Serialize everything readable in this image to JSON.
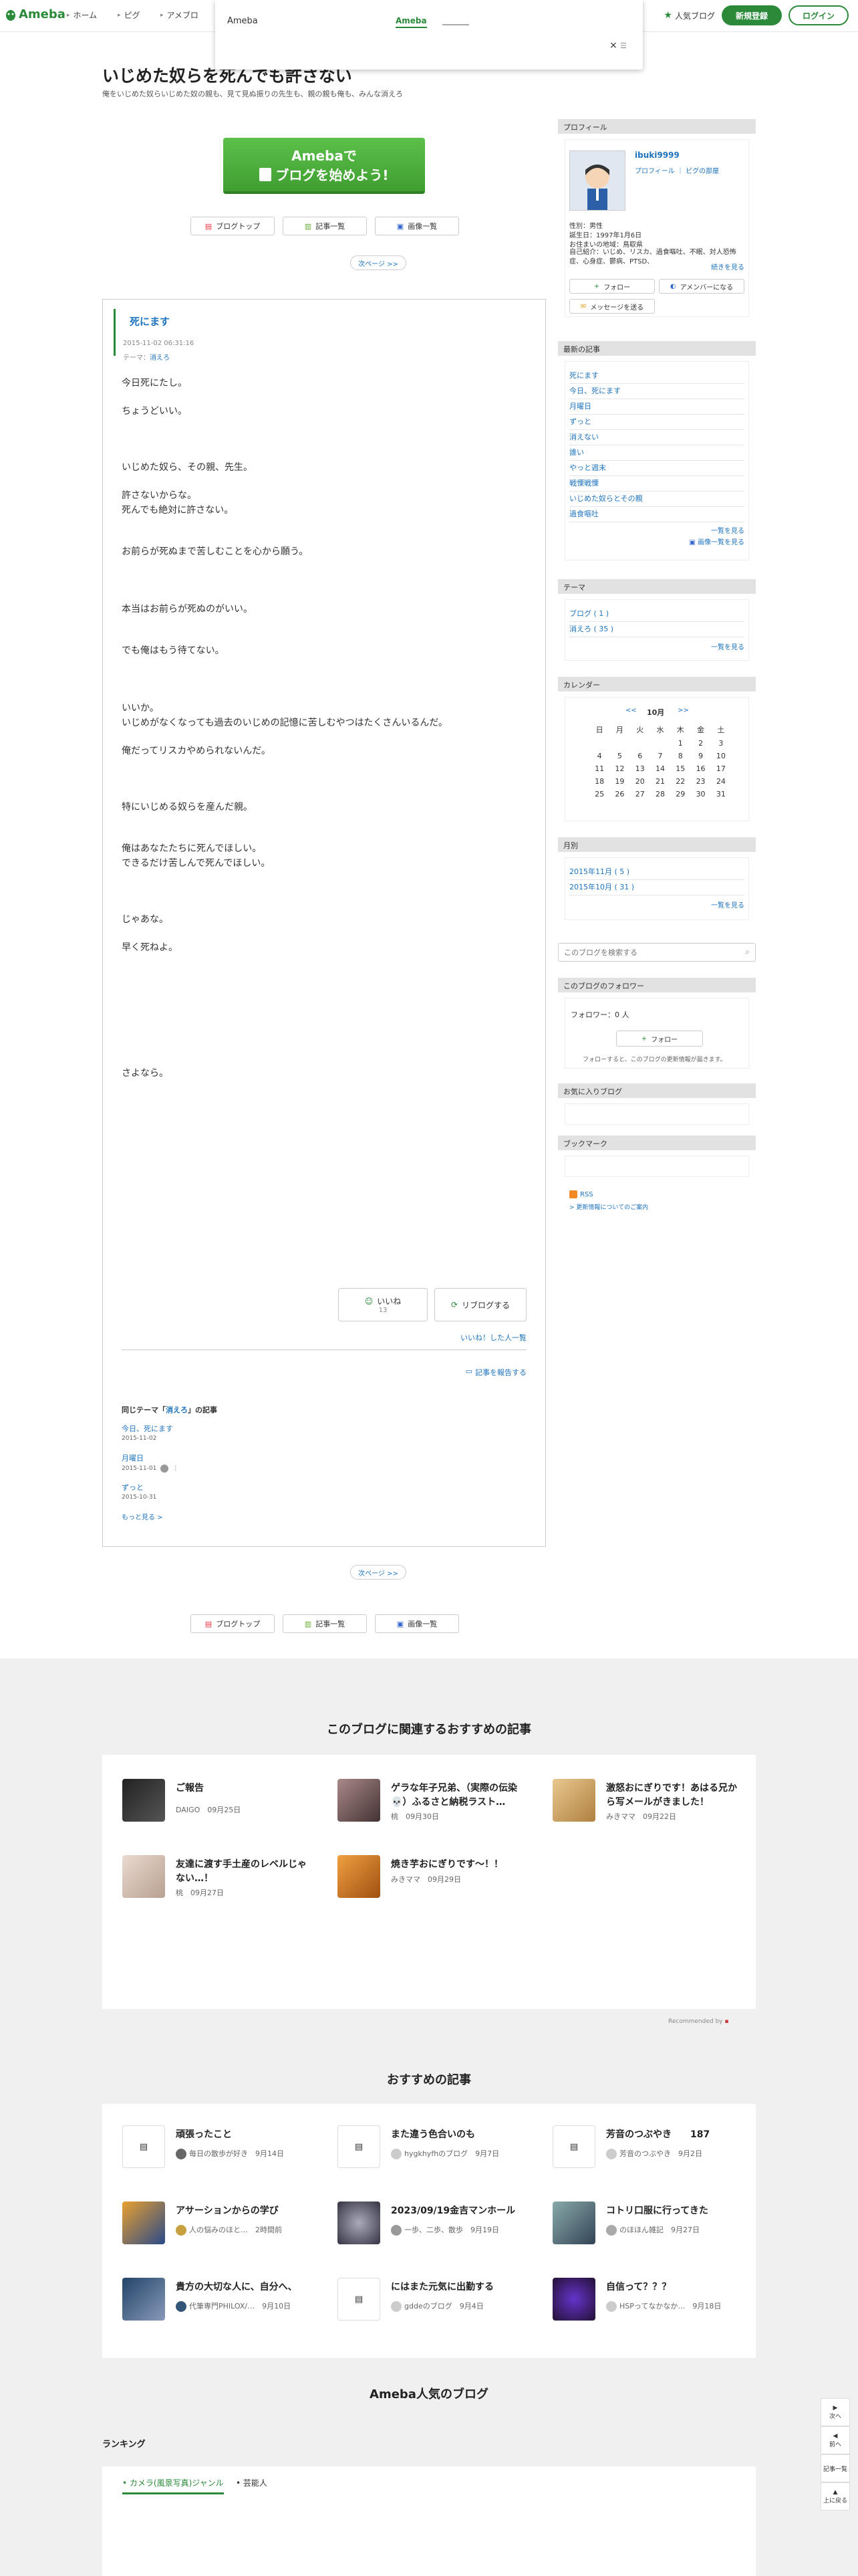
{
  "header": {
    "logo": "Ameba",
    "nav": [
      "ホーム",
      "ピグ",
      "アメブロ"
    ],
    "popup_title": "Ameba",
    "popup_link": "Ameba",
    "popup_close": "×",
    "popular": "人気ブログ",
    "signup": "新規登録",
    "login": "ログイン"
  },
  "blog": {
    "title": "いじめた奴らを死んでも許さない",
    "description": "俺をいじめた奴らいじめた奴の親も、見て見ぬ振りの先生も、親の親も俺も、みんな消えろ"
  },
  "banner": {
    "line1": "Amebaで",
    "line2": "ブログを始めよう!"
  },
  "blog_nav": {
    "top": "ブログトップ",
    "list": "記事一覧",
    "images": "画像一覧",
    "next": "次ページ >>"
  },
  "article": {
    "title": "死にます",
    "date": "2015-11-02 06:31:16",
    "theme_label": "テーマ：",
    "theme": "消えろ",
    "body": [
      "今日死にたし。",
      "ちょうどいい。",
      "いじめた奴ら、その親、先生。",
      "許さないからな。",
      "死んでも絶対に許さない。",
      "お前らが死ぬまで苦しむことを心から願う。",
      "本当はお前らが死ぬのがいい。",
      "でも俺はもう待てない。",
      "いいか。",
      "いじめがなくなっても過去のいじめの記憶に苦しむやつはたくさんいるんだ。",
      "俺だってリスカやめられないんだ。",
      "特にいじめる奴らを産んだ親。",
      "俺はあなたたちに死んでほしい。",
      "できるだけ苦しんで死んでほしい。",
      "じゃあな。",
      "早く死ねよ。",
      "さよなら。"
    ],
    "like": "いいね",
    "like_count": "13",
    "reblog": "リブログする",
    "liked_by": "いいね！した人一覧",
    "report": "記事を報告する",
    "same_theme_prefix": "同じテーマ「",
    "same_theme_name": "消えろ",
    "same_theme_suffix": "」の記事",
    "related": [
      {
        "title": "今日、死にます",
        "date": "2015-11-02"
      },
      {
        "title": "月曜日",
        "date": "2015-11-01"
      },
      {
        "title": "ずっと",
        "date": "2015-10-31"
      }
    ],
    "more": "もっと見る >"
  },
  "sidebar": {
    "profile": {
      "heading": "プロフィール",
      "name": "ibuki9999",
      "links": "プロフィール ｜ ピグの部屋",
      "gender": "性別：男性",
      "birthday": "誕生日：1997年1月6日",
      "region": "お住まいの地域：鳥取県",
      "intro": "自己紹介：いじめ、リスカ、過食嘔吐、不眠、対人恐怖症、心身症、鬱病、PTSD、",
      "read_more": "続きを見る",
      "follow": "フォロー",
      "member": "アメンバーになる",
      "message": "メッセージを送る"
    },
    "recent": {
      "heading": "最新の記事",
      "items": [
        "死にます",
        "今日、死にます",
        "月曜日",
        "ずっと",
        "消えない",
        "誰い",
        "やっと週末",
        "戦慄戦慄",
        "いじめた奴らとその親",
        "過食嘔吐"
      ],
      "more": "一覧を見る",
      "images": "画像一覧を見る"
    },
    "theme": {
      "heading": "テーマ",
      "items": [
        "ブログ ( 1 )",
        "消えろ ( 35 )"
      ],
      "more": "一覧を見る"
    },
    "calendar": {
      "heading": "カレンダー",
      "prev": "<<",
      "month": "10月",
      "next": ">>",
      "weekdays": [
        "日",
        "月",
        "火",
        "水",
        "木",
        "金",
        "土"
      ],
      "rows": [
        [
          "",
          "",
          "",
          "",
          "",
          "",
          "7"
        ],
        [
          "1",
          "2",
          "3",
          "4",
          "5",
          "6",
          "7"
        ]
      ],
      "days": [
        "1",
        "2",
        "3",
        "4",
        "5",
        "6",
        "7",
        "8",
        "9",
        "10",
        "11",
        "12",
        "13",
        "14",
        "15",
        "16",
        "17",
        "18",
        "19",
        "20",
        "21",
        "22",
        "23",
        "24",
        "25",
        "26",
        "27",
        "28",
        "29",
        "30",
        "31"
      ]
    },
    "archive": {
      "heading": "月別",
      "items": [
        "2015年11月 ( 5 )",
        "2015年10月 ( 31 )"
      ],
      "more": "一覧を見る"
    },
    "search_placeholder": "このブログを検索する",
    "followers": {
      "heading": "このブログのフォロワー",
      "count": "フォロワー：0 人",
      "button": "フォロー",
      "note": "フォローすると、このブログの更新情報が届きます。"
    },
    "favorites": {
      "heading": "お気に入りブログ"
    },
    "bookmarks": {
      "heading": "ブックマーク"
    },
    "rss": "RSS",
    "rss_help": "> 更新情報についてのご案内"
  },
  "related_section": {
    "heading": "このブログに関連するおすすめの記事",
    "items": [
      {
        "title": "ご報告",
        "author": "DAIGO",
        "date": "09月25日"
      },
      {
        "title": "ゲラな年子兄弟、（実際の伝染💀）ふるさと納税ラスト…",
        "author": "桃",
        "date": "09月30日"
      },
      {
        "title": "激怒おにぎりです！あはる兄から写メールがきました！",
        "author": "みきママ",
        "date": "09月22日"
      },
      {
        "title": "友達に渡す手土産のレベルじゃない…！",
        "author": "桃",
        "date": "09月27日"
      },
      {
        "title": "焼き芋おにぎりです～！！",
        "author": "みきママ",
        "date": "09月29日"
      }
    ],
    "recommended_by": "Recommended by"
  },
  "osusume": {
    "heading": "おすすめの記事",
    "items": [
      {
        "title": "頑張ったこと",
        "author": "毎日の散歩が好き",
        "date": "9月14日"
      },
      {
        "title": "また違う色合いのも",
        "author": "hygkhyfhのブログ",
        "date": "9月7日"
      },
      {
        "title": "芳音のつぶやき　　187",
        "author": "芳音のつぶやき",
        "date": "9月2日"
      },
      {
        "title": "アサーションからの学び",
        "author": "人の悩みのほと…",
        "date": "2時間前"
      },
      {
        "title": "2023/09/19金吉マンホール",
        "author": "一歩、二歩、散歩",
        "date": "9月19日"
      },
      {
        "title": "コトリ口服に行ってきた",
        "author": "のほほん雑記",
        "date": "9月27日"
      },
      {
        "title": "貴方の大切な人に、自分へ、",
        "author": "代筆専門PHILOX/…",
        "date": "9月10日"
      },
      {
        "title": "にはまた元気に出勤する",
        "author": "gddeのブログ",
        "date": "9月4日"
      },
      {
        "title": "自信って？？？",
        "author": "HSPってなかなか…",
        "date": "9月18日"
      }
    ]
  },
  "popular": {
    "heading": "Ameba人気のブログ",
    "ranking": "ランキング",
    "tab1": "カメラ(風景写真)ジャンル",
    "tab2": "芸能人"
  },
  "float": {
    "next": "次へ",
    "prev": "前へ",
    "list": "記事一覧",
    "top": "上に戻る"
  },
  "colors": {
    "accent": "#2a8a3a",
    "link": "#1e73be",
    "banner": "#4fae3a"
  }
}
